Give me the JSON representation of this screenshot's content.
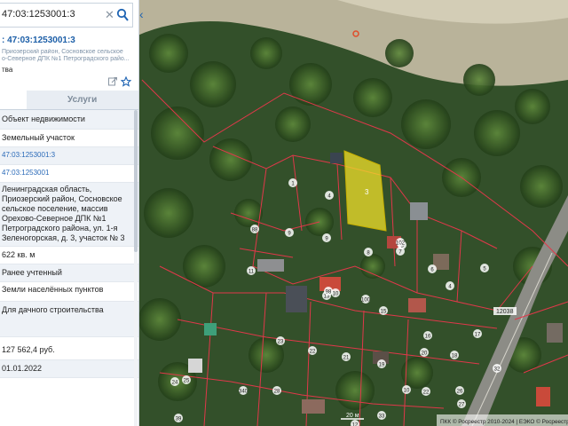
{
  "search": {
    "query": "47:03:1253001:3"
  },
  "card": {
    "title": "47:03:1253001:3",
    "address_line1": "Приозерский район, Сосновское сельское",
    "address_line2": "о-Северное ДПК №1 Петроградского райо...",
    "subtitle": "тва"
  },
  "tabs": {
    "services": "Услуги"
  },
  "rows": [
    {
      "id": "type",
      "text": "Объект недвижимости"
    },
    {
      "id": "kind",
      "text": "Земельный участок"
    },
    {
      "id": "cad_number",
      "text": "47:03:1253001:3"
    },
    {
      "id": "cad_quarter",
      "text": "47:03:1253001"
    },
    {
      "id": "address",
      "lines": [
        "Ленинградская область,",
        "Приозерский район, Сосновское",
        "сельское поселение, массив",
        "Орехово-Северное ДПК №1",
        "Петроградского района, ул. 1-я",
        "Зеленогорская, д. 3, участок № 3"
      ]
    },
    {
      "id": "area",
      "text": "622 кв. м"
    },
    {
      "id": "status",
      "text": "Ранее учтенный"
    },
    {
      "id": "category",
      "text": "Земли населённых пунктов"
    },
    {
      "id": "use",
      "text": "Для дачного строительства"
    },
    {
      "id": "cad_value",
      "text": "127 562,4 руб."
    },
    {
      "id": "date",
      "text": "01.01.2022"
    }
  ],
  "map": {
    "highlight_color": "#f2e02a",
    "boundary_color": "#e0384a",
    "highlight_label": "3",
    "parcel_labels": [
      "1",
      "4",
      "8",
      "88",
      "9",
      "10",
      "9",
      "7",
      "8",
      "6",
      "5",
      "11",
      "15",
      "13",
      "98",
      "102",
      "100",
      "4",
      "16",
      "17",
      "18",
      "23",
      "22",
      "21",
      "19",
      "20",
      "12",
      "24",
      "25",
      "340",
      "28",
      "39",
      "10",
      "22",
      "26",
      "32",
      "27",
      "33"
    ],
    "road_label": "12038",
    "scale_label": "20 м",
    "attribution": "ПКК © Росреестр 2010-2024 | ЕЭКО © Росреестр",
    "icons": [
      "share-icon",
      "star-icon",
      "search-icon",
      "close-icon",
      "collapse-icon"
    ]
  }
}
